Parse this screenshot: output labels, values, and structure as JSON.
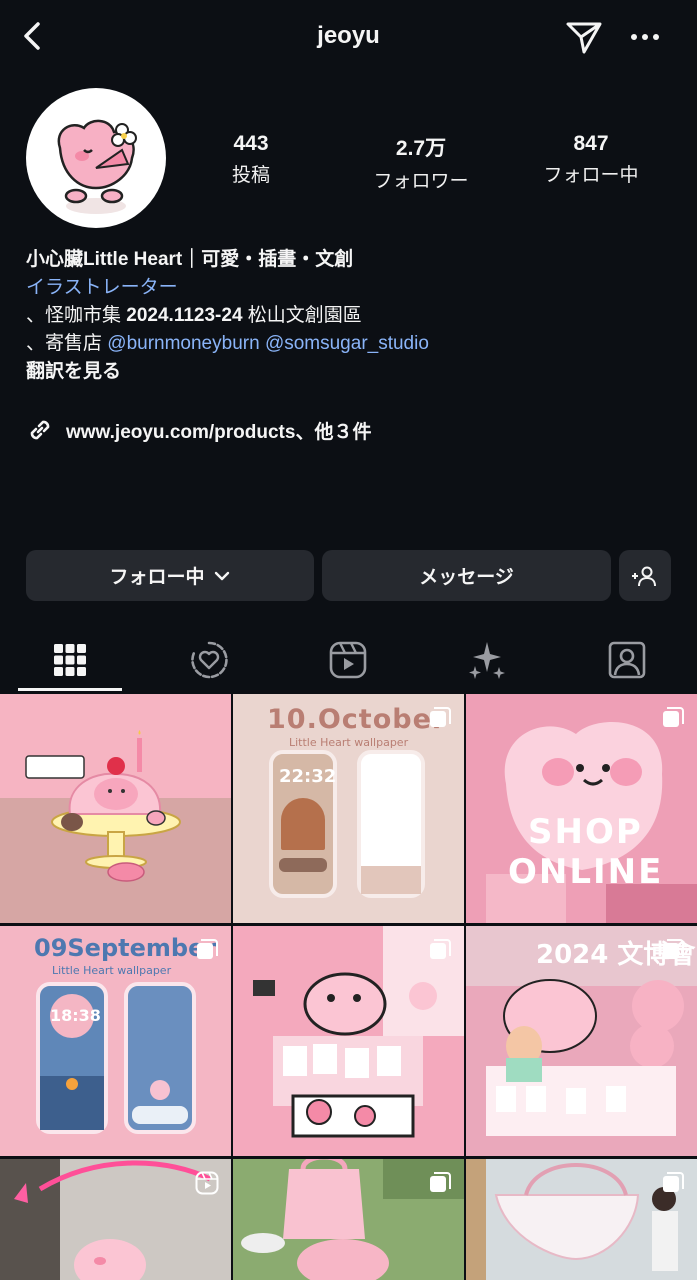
{
  "header": {
    "username": "jeoyu"
  },
  "stats": [
    {
      "value": "443",
      "label": "投稿"
    },
    {
      "value": "2.7万",
      "label": "フォロワー"
    },
    {
      "value": "847",
      "label": "フォロー中"
    }
  ],
  "bio": {
    "name_line": "小心臟Little Heart｜可愛・插畫・文創",
    "category": "イラストレーター",
    "line1_prefix": "、怪咖市集 ",
    "line1_bold": "2024.1123-24",
    "line1_suffix": " 松山文創園區",
    "line2_prefix": "、寄售店 ",
    "mention1": "@burnmoneyburn",
    "mention2": "@somsugar_studio",
    "translate": "翻訳を見る"
  },
  "link": {
    "text": "www.jeoyu.com/products、他３件"
  },
  "actions": {
    "follow_label": "フォロー中",
    "message_label": "メッセージ"
  },
  "grid": {
    "post2_title": "10.October",
    "post2_sub": "Little Heart wallpaper",
    "post2_time": "22:32",
    "post3_line1": "SHOP",
    "post3_line2": "ONLINE",
    "post4_title": "09September",
    "post4_sub": "Little Heart wallpaper",
    "post4_time": "18:38",
    "post6_title": "2024 文博會"
  },
  "colors": {
    "background": "#0c0f14",
    "button": "#26292f",
    "link_blue": "#8ab4f8",
    "pink": "#f4a7bd"
  },
  "icons": {
    "back": "chevron-left-icon",
    "send": "paper-plane-icon",
    "more": "more-dots-icon",
    "link": "link-icon",
    "add_user": "add-user-icon",
    "tab_grid": "grid-icon",
    "tab_heart_circle": "heart-circle-icon",
    "tab_reels": "reels-icon",
    "tab_sparkle": "sparkle-icon",
    "tab_tagged": "tagged-person-icon"
  }
}
